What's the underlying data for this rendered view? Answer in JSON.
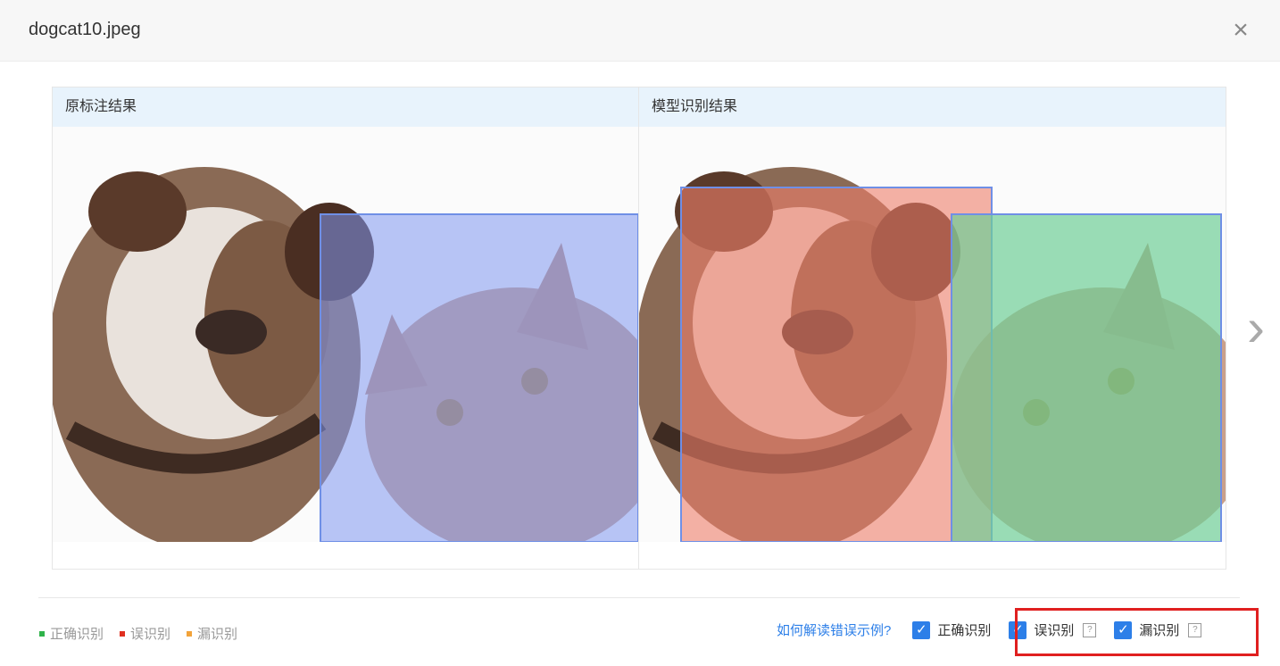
{
  "dialog": {
    "title": "dogcat10.jpeg",
    "close_symbol": "×"
  },
  "panels": {
    "left": {
      "title": "原标注结果"
    },
    "right": {
      "title": "模型识别结果"
    }
  },
  "nav": {
    "next_symbol": "›"
  },
  "legend": [
    {
      "label": "正确识别",
      "color": "#2fb34a"
    },
    {
      "label": "误识别",
      "color": "#e03020"
    },
    {
      "label": "漏识别",
      "color": "#f2a33a"
    }
  ],
  "controls": {
    "help_link": "如何解读错误示例?",
    "checkboxes": [
      {
        "label": "正确识别",
        "checked": true
      },
      {
        "label": "误识别",
        "checked": true,
        "help": "?"
      },
      {
        "label": "漏识别",
        "checked": true,
        "help": "?"
      }
    ]
  },
  "colors": {
    "accent": "#2d7fe8",
    "annotation_box": "#6f8fe6",
    "false_detection_box": "#ef8a78",
    "correct_box": "#6fcf97",
    "highlight": "#e02020"
  }
}
